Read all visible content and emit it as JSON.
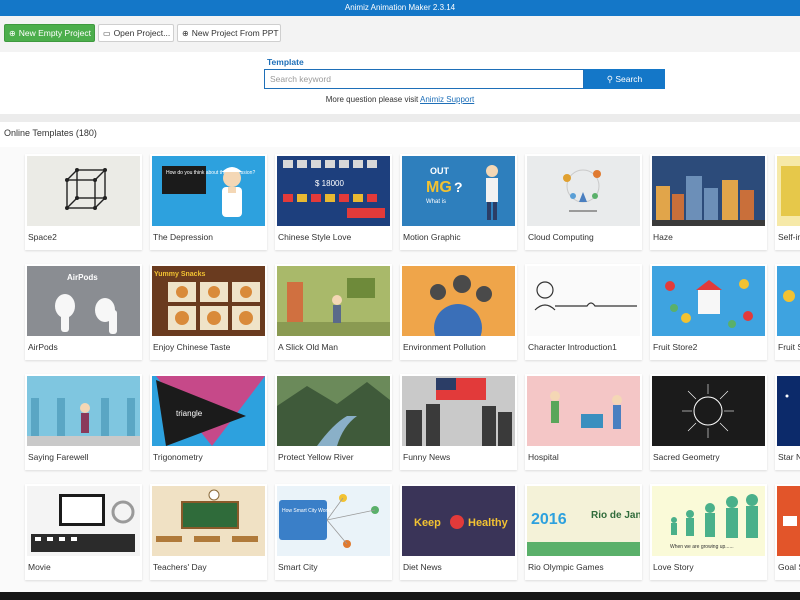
{
  "window": {
    "title": "Animiz Animation Maker 2.3.14"
  },
  "toolbar": {
    "new_empty_label": "New Empty Project",
    "open_label": "Open Project...",
    "new_ppt_label": "New Project From PPT"
  },
  "search": {
    "label": "Template",
    "placeholder": "Search keyword",
    "button_label": "Search",
    "help_text": "More question please visit",
    "help_link": "Animiz Support"
  },
  "templates": {
    "section_title": "Online Templates (180)",
    "rows": [
      [
        "Space2",
        "The Depression",
        "Chinese Style Love",
        "Motion Graphic",
        "Cloud Computing",
        "Haze",
        "Self-in"
      ],
      [
        "AirPods",
        "Enjoy Chinese Taste",
        "A Slick Old Man",
        "Environment Pollution",
        "Character Introduction1",
        "Fruit Store2",
        "Fruit S"
      ],
      [
        "Saying Farewell",
        "Trigonometry",
        "Protect Yellow River",
        "Funny News",
        "Hospital",
        "Sacred Geometry",
        "Star N"
      ],
      [
        "Movie",
        "Teachers' Day",
        "Smart City",
        "Diet News",
        "Rio Olympic Games",
        "Love Story",
        "Goal S"
      ]
    ],
    "thumb_text": {
      "depression": "How do you think about the depression?",
      "chinese_value": "$ 18000",
      "motion_out": "OUT",
      "motion_mg": "MG",
      "motion_q": "?",
      "motion_what": "What is",
      "airpods": "AirPods",
      "yummy": "Yummy Snacks",
      "triangle": "triangle",
      "smart_city": "How Smart City Works ?",
      "diet_keep": "Keep",
      "diet_healthy": "Healthy",
      "rio_year": "2016",
      "rio_city": "Rio de Janeiro",
      "love": "When we are growing up......"
    }
  },
  "colors": {
    "titlebar": "#1477c8",
    "primary_button": "#4cae4c",
    "search_button": "#1477c8",
    "link": "#1e6fb8"
  }
}
